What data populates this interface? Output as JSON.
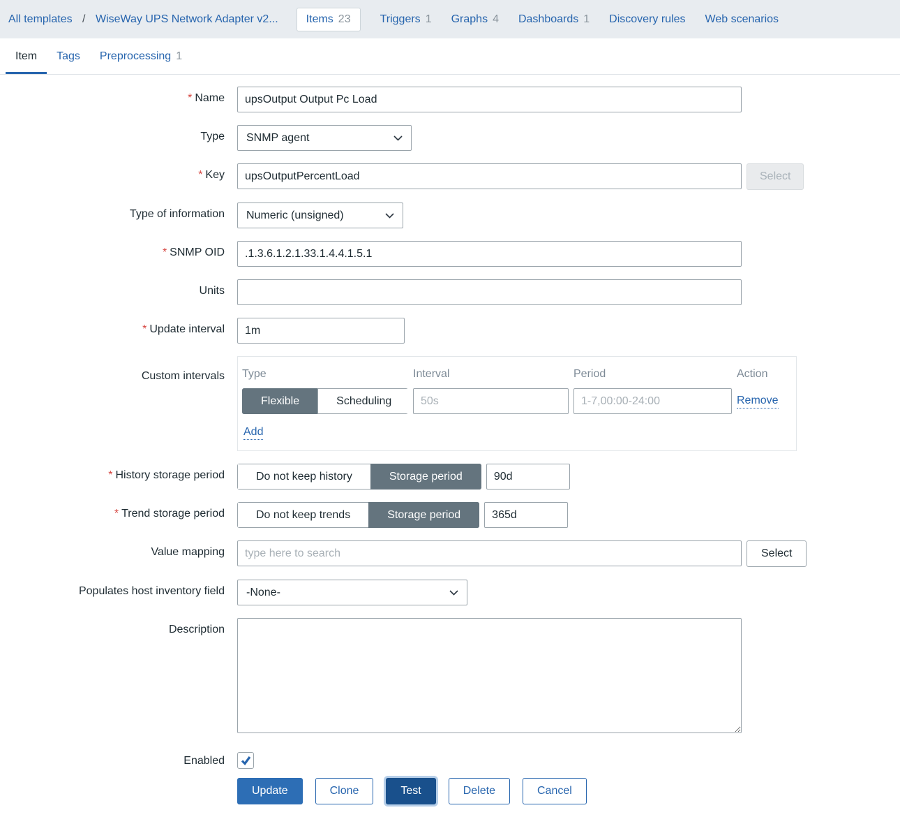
{
  "breadcrumb": {
    "separator": "/",
    "items": [
      {
        "label": "All templates"
      },
      {
        "label": "WiseWay UPS Network Adapter v2..."
      }
    ]
  },
  "top_nav": {
    "tabs": [
      {
        "label": "Items",
        "count": "23",
        "active": true
      },
      {
        "label": "Triggers",
        "count": "1"
      },
      {
        "label": "Graphs",
        "count": "4"
      },
      {
        "label": "Dashboards",
        "count": "1"
      },
      {
        "label": "Discovery rules"
      },
      {
        "label": "Web scenarios"
      }
    ]
  },
  "form_tabs": [
    {
      "label": "Item",
      "active": true
    },
    {
      "label": "Tags"
    },
    {
      "label": "Preprocessing",
      "count": "1"
    }
  ],
  "ui": {
    "required_marker": "*"
  },
  "form": {
    "name": {
      "label": "Name",
      "value": "upsOutput Output Pc Load"
    },
    "type": {
      "label": "Type",
      "value": "SNMP agent"
    },
    "key": {
      "label": "Key",
      "value": "upsOutputPercentLoad",
      "select_button": "Select"
    },
    "type_of_information": {
      "label": "Type of information",
      "value": "Numeric (unsigned)"
    },
    "snmp_oid": {
      "label": "SNMP OID",
      "value": ".1.3.6.1.2.1.33.1.4.4.1.5.1"
    },
    "units": {
      "label": "Units",
      "value": ""
    },
    "update_interval": {
      "label": "Update interval",
      "value": "1m"
    },
    "custom_intervals": {
      "label": "Custom intervals",
      "columns": {
        "type": "Type",
        "interval": "Interval",
        "period": "Period",
        "action": "Action"
      },
      "row": {
        "type_flexible": "Flexible",
        "type_scheduling": "Scheduling",
        "type_selected": "Flexible",
        "interval_placeholder": "50s",
        "period_placeholder": "1-7,00:00-24:00",
        "action_label": "Remove"
      },
      "add_label": "Add"
    },
    "history": {
      "label": "History storage period",
      "option_off": "Do not keep history",
      "option_on": "Storage period",
      "selected": "Storage period",
      "value": "90d"
    },
    "trends": {
      "label": "Trend storage period",
      "option_off": "Do not keep trends",
      "option_on": "Storage period",
      "selected": "Storage period",
      "value": "365d"
    },
    "value_mapping": {
      "label": "Value mapping",
      "placeholder": "type here to search",
      "select_button": "Select"
    },
    "inventory": {
      "label": "Populates host inventory field",
      "value": "-None-"
    },
    "description": {
      "label": "Description",
      "value": ""
    },
    "enabled": {
      "label": "Enabled",
      "checked": true
    }
  },
  "footer": {
    "update": "Update",
    "clone": "Clone",
    "test": "Test",
    "delete": "Delete",
    "cancel": "Cancel"
  },
  "colors": {
    "accent_blue": "#2765ae",
    "primary_button": "#2d6eb5",
    "test_button": "#19508c",
    "segment_selected": "#64747e",
    "topbar_bg": "#e8ecf0",
    "required_red": "#d64540"
  }
}
